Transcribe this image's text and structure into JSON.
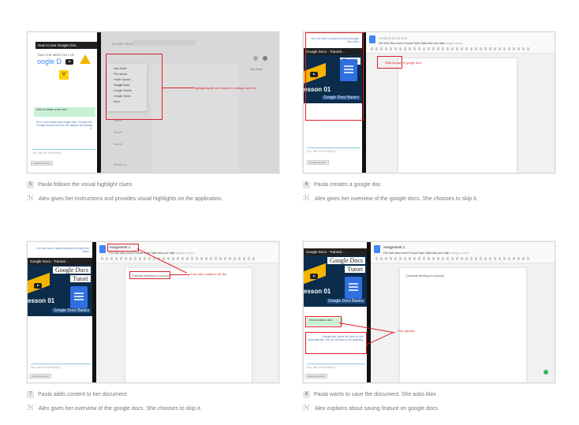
{
  "steps": [
    {
      "number": "5",
      "caption": "Paula follows the visual highlight clues",
      "note": "Alex gives her instructions and provides visual highlights on the application.",
      "video_title": "How to Use Google Driv...",
      "video_text_1": "TING THE MOST OUT OF",
      "video_text_2": "oogle D",
      "chat_instruction": "How to create a new doc.",
      "chat_reply": "Go to new button and single click. Choose the Google document from the options by clicking it.",
      "chat_input_hint": "Say, ask me something...",
      "annotation": "Highlighting the new button to creating a new doc",
      "app_title": "Google Drive",
      "menu_items": [
        "New folder",
        "File upload",
        "Folder upload",
        "Google Docs",
        "Google Sheets",
        "Google Slides",
        "More"
      ],
      "side_items": [
        "Shared",
        "Recent",
        "Starred",
        "Backed up"
      ],
      "right_panel": "My Drive",
      "button_label": "Another account"
    },
    {
      "number": "6",
      "caption": "Paula creates a google doc",
      "note": "Alex gives her overview of the google docs. She chooses to skip it.",
      "chat_top": "You can have a quick overview through this video",
      "video_title": "Google Docs - Tutorial ...",
      "lesson": "esson 01",
      "video_t1": "Google Docs Basics",
      "video_t2": "Tutori",
      "annotation": "Walk through of google docs",
      "chat_input_hint": "Say, ask me something...",
      "doc_name": "Untitled document",
      "menus": "File  Edit  View  Insert  Format  Tools  Table  Add-ons  Help",
      "saved": "All changes saved",
      "button_label": "Another account"
    },
    {
      "number": "7",
      "caption": "Paula adds content to her document",
      "note": "Alex gives her overview of the google docs. She chooses to skip it.",
      "chat_top": "You can have a quick overview through this video",
      "video_title": "Google Docs - Tutorial ...",
      "video_t1": "Google Docs",
      "video_t2": "Tutori",
      "lesson": "esson 01",
      "video_t3": "Google Docs Basics",
      "doc_name": "Assignment 1",
      "menus": "File  Edit  View  Insert  Format  Tools  Table  Add-ons  Help",
      "saved": "All changes saved",
      "doc_text": "[Tutorials Meeting on a person]",
      "annotation": "User adds content to the doc",
      "chat_input_hint": "Say, ask me something...",
      "button_label": "Another account"
    },
    {
      "number": "8",
      "caption": "Paula wants to save the document. She asks Alex",
      "note": "Alex explains about saving feature on google docs",
      "video_title": "Google Docs - Tutorial ...",
      "video_t1": "Google Docs",
      "video_t2": "Tutori",
      "lesson": "esson 01",
      "video_t3": "Google Docs Basics",
      "doc_name": "Assignment 1",
      "menus": "File  Edit  View  Insert  Format  Tools  Table  Add-ons  Help",
      "saved": "All changes saved",
      "doc_text": "[Tutorials Meeting on a person]",
      "chat_question": "How to save a doc.",
      "chat_reply": "Google doc saves the files for you automatically. You do not have to do anything.",
      "annotation": "User question",
      "chat_input_hint": "Say, ask me something...",
      "button_label": "Another account"
    }
  ],
  "colors": {
    "annotation": "#d9212a",
    "chat_green": "#c9f1d6",
    "docs_blue": "#4285f4"
  }
}
